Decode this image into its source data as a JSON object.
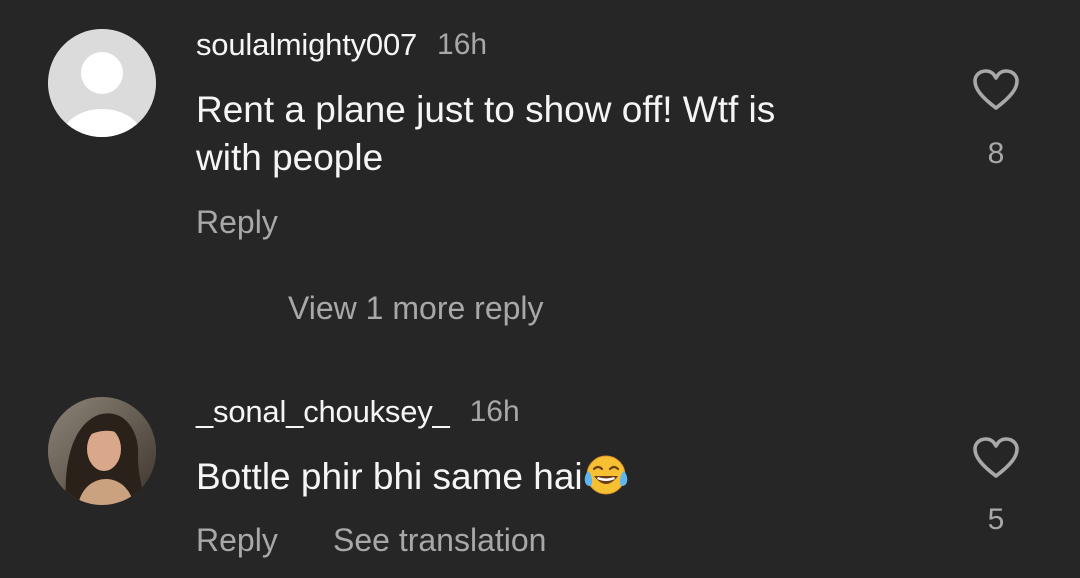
{
  "comments": [
    {
      "username": "soulalmighty007",
      "time": "16h",
      "text_lines": [
        "Rent a plane just to show off! Wtf is",
        "with people"
      ],
      "likes": "8",
      "avatar": "default-user-avatar",
      "reply_label": "Reply",
      "view_replies_label": "View 1 more reply"
    },
    {
      "username": "_sonal_chouksey_",
      "time": "16h",
      "text": "Bottle phir bhi same hai",
      "emoji": "face-with-tears-of-joy",
      "likes": "5",
      "avatar": "profile-photo",
      "reply_label": "Reply",
      "translate_label": "See translation"
    }
  ],
  "icons": {
    "like": "heart-outline-icon"
  },
  "colors": {
    "background": "#262626",
    "primary_text": "#f5f5f5",
    "secondary_text": "#a8a8a8",
    "default_avatar": "#dbdbdb"
  }
}
